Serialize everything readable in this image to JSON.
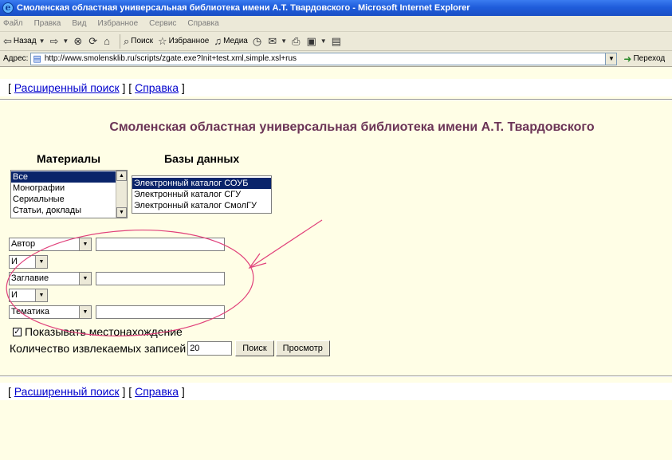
{
  "window": {
    "title": "Смоленская областная универсальная библиотека имени А.Т. Твардовского - Microsoft Internet Explorer"
  },
  "menu": [
    "Файл",
    "Правка",
    "Вид",
    "Избранное",
    "Сервис",
    "Справка"
  ],
  "toolbar": {
    "back": "Назад",
    "search": "Поиск",
    "favorites": "Избранное",
    "media": "Медиа"
  },
  "address": {
    "label": "Адрес:",
    "url": "http://www.smolensklib.ru/scripts/zgate.exe?Init+test.xml,simple.xsl+rus",
    "go": "Переход"
  },
  "nav": {
    "advanced_search": "Расширенный поиск",
    "help": "Справка"
  },
  "page_title": "Смоленская областная универсальная библиотека имени А.Т. Твардовского",
  "materials": {
    "heading": "Материалы",
    "options": [
      "Все",
      "Монографии",
      "Сериальные",
      "Статьи, доклады"
    ],
    "selected_index": 0
  },
  "databases": {
    "heading": "Базы данных",
    "options": [
      "Электронный каталог СОУБ",
      "Электронный каталог СГУ",
      "Электронный каталог СмолГУ"
    ],
    "selected_index": 0
  },
  "search_rows": [
    {
      "field": "Автор",
      "value": ""
    },
    {
      "field": "Заглавие",
      "value": ""
    },
    {
      "field": "Тематика",
      "value": ""
    }
  ],
  "operators": [
    "И",
    "И"
  ],
  "show_location": {
    "label": "Показывать местонахождение",
    "checked": true
  },
  "record_count": {
    "label": "Количество извлекаемых записей",
    "value": "20"
  },
  "buttons": {
    "search": "Поиск",
    "view": "Просмотр"
  },
  "colors": {
    "title": "#6b3456",
    "link": "#0000cc",
    "page_bg": "#fffee6",
    "annotation": "#e0407a"
  }
}
